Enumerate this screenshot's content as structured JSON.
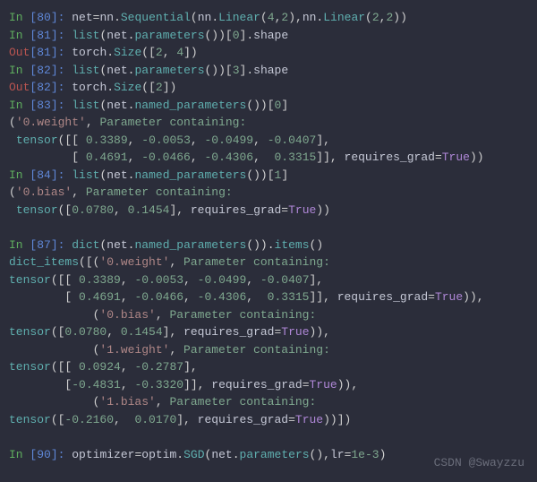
{
  "lines": {
    "l1": {
      "prompt": "In [",
      "n": "80",
      "close": "]: ",
      "code": "net=nn.Sequential(nn.Linear(4,2),nn.Linear(2,2))"
    },
    "l2": {
      "prompt": "In [",
      "n": "81",
      "close": "]: ",
      "code": "list(net.parameters())[0].shape"
    },
    "l3": {
      "prompt": "Out[",
      "n": "81",
      "close": "]: ",
      "code": "torch.Size([2, 4])"
    },
    "l4": {
      "prompt": "In [",
      "n": "82",
      "close": "]: ",
      "code": "list(net.parameters())[3].shape"
    },
    "l5": {
      "prompt": "Out[",
      "n": "82",
      "close": "]: ",
      "code": "torch.Size([2])"
    },
    "l6": {
      "prompt": "In [",
      "n": "83",
      "close": "]: ",
      "code": "list(net.named_parameters())[0]"
    },
    "l7": "('0.weight', Parameter containing:",
    "l8": " tensor([[ 0.3389, -0.0053, -0.0499, -0.0407],",
    "l9": "         [ 0.4691, -0.0466, -0.4306,  0.3315]], requires_grad=True))",
    "l10": {
      "prompt": "In [",
      "n": "84",
      "close": "]: ",
      "code": "list(net.named_parameters())[1]"
    },
    "l11": "('0.bias', Parameter containing:",
    "l12": " tensor([0.0780, 0.1454], requires_grad=True))",
    "l13": "",
    "l14": {
      "prompt": "In [",
      "n": "87",
      "close": "]: ",
      "code": "dict(net.named_parameters()).items()"
    },
    "l15": "dict_items([('0.weight', Parameter containing:",
    "l16": "tensor([[ 0.3389, -0.0053, -0.0499, -0.0407],",
    "l17": "        [ 0.4691, -0.0466, -0.4306,  0.3315]], requires_grad=True)),",
    "l18": "            ('0.bias', Parameter containing:",
    "l19": "tensor([0.0780, 0.1454], requires_grad=True)),",
    "l20": "            ('1.weight', Parameter containing:",
    "l21": "tensor([[ 0.0924, -0.2787],",
    "l22": "        [-0.4831, -0.3320]], requires_grad=True)),",
    "l23": "            ('1.bias', Parameter containing:",
    "l24": "tensor([-0.2160,  0.0170], requires_grad=True))])",
    "l25": "",
    "l26": {
      "prompt": "In [",
      "n": "90",
      "close": "]: ",
      "code": "optimizer=optim.SGD(net.parameters(),lr=1e-3)"
    }
  },
  "watermark": "CSDN @Swayzzu"
}
